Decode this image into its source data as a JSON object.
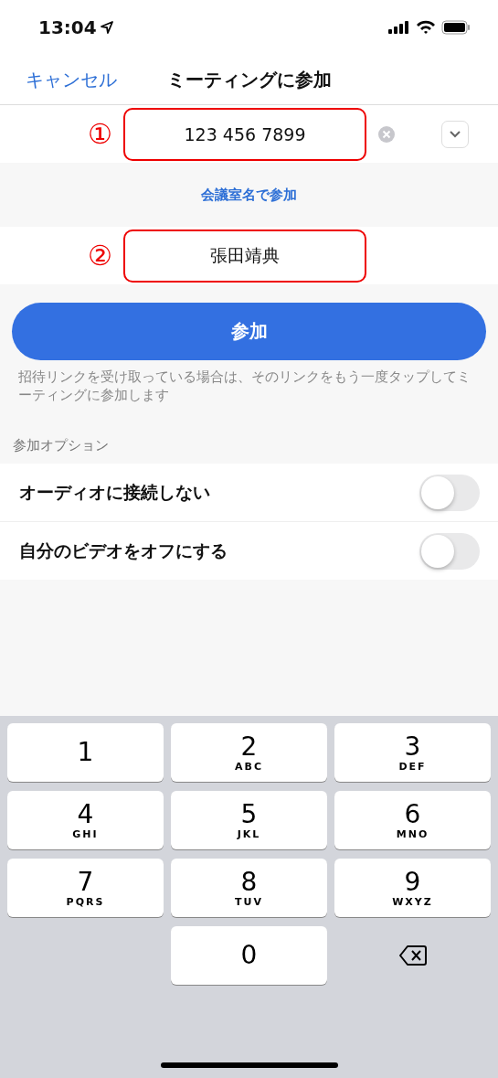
{
  "status_bar": {
    "time": "13:04"
  },
  "nav": {
    "cancel": "キャンセル",
    "title": "ミーティングに参加"
  },
  "meeting_id": {
    "marker": "①",
    "value": "123 456 7899"
  },
  "room_name_link": "会議室名で参加",
  "name": {
    "marker": "②",
    "value": "張田靖典"
  },
  "join_button": "参加",
  "help_text": "招待リンクを受け取っている場合は、そのリンクをもう一度タップしてミーティングに参加します",
  "options_header": "参加オプション",
  "options": [
    {
      "label": "オーディオに接続しない",
      "on": false
    },
    {
      "label": "自分のビデオをオフにする",
      "on": false
    }
  ],
  "keyboard": [
    {
      "kind": "digit",
      "digit": "1"
    },
    {
      "kind": "digit",
      "digit": "2",
      "letters": "ABC"
    },
    {
      "kind": "digit",
      "digit": "3",
      "letters": "DEF"
    },
    {
      "kind": "digit",
      "digit": "4",
      "letters": "GHI"
    },
    {
      "kind": "digit",
      "digit": "5",
      "letters": "JKL"
    },
    {
      "kind": "digit",
      "digit": "6",
      "letters": "MNO"
    },
    {
      "kind": "digit",
      "digit": "7",
      "letters": "PQRS"
    },
    {
      "kind": "digit",
      "digit": "8",
      "letters": "TUV"
    },
    {
      "kind": "digit",
      "digit": "9",
      "letters": "WXYZ"
    },
    {
      "kind": "blank"
    },
    {
      "kind": "digit",
      "digit": "0"
    },
    {
      "kind": "delete"
    }
  ]
}
